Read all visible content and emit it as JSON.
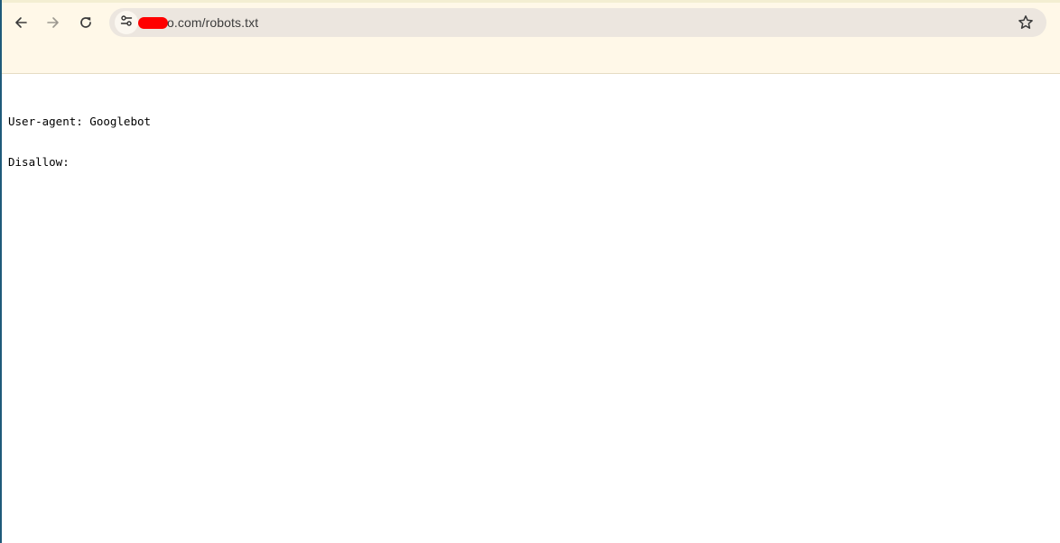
{
  "browser": {
    "url_visible": "o.com/robots.txt",
    "icons": {
      "back": "arrow-left-icon",
      "forward": "arrow-right-icon",
      "reload": "reload-icon",
      "site_info": "tune-icon",
      "bookmark": "star-outline-icon"
    },
    "colors": {
      "toolbar_bg": "#fff8e8",
      "omnibox_bg": "#ece6df",
      "redaction": "#ff0000"
    }
  },
  "document": {
    "lines": [
      "User-agent: Googlebot",
      "Disallow:"
    ]
  }
}
